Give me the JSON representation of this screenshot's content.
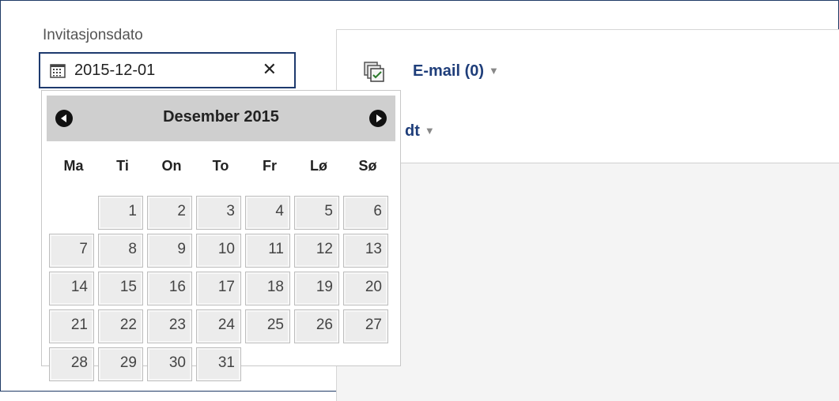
{
  "field": {
    "label": "Invitasjonsdato",
    "value": "2015-12-01"
  },
  "panel": {
    "email_tab": "E-mail (0)",
    "second_tab_visible": "dt"
  },
  "datepicker": {
    "month_title": "Desember 2015",
    "weekdays": [
      "Ma",
      "Ti",
      "On",
      "To",
      "Fr",
      "Lø",
      "Sø"
    ],
    "leading_blanks": 1,
    "days": [
      "1",
      "2",
      "3",
      "4",
      "5",
      "6",
      "7",
      "8",
      "9",
      "10",
      "11",
      "12",
      "13",
      "14",
      "15",
      "16",
      "17",
      "18",
      "19",
      "20",
      "21",
      "22",
      "23",
      "24",
      "25",
      "26",
      "27",
      "28",
      "29",
      "30",
      "31"
    ]
  },
  "icons": {
    "calendar": "calendar-icon",
    "clear": "close-icon",
    "email": "email-checkbox-icon",
    "prev": "prev-month-icon",
    "next": "next-month-icon"
  },
  "colors": {
    "border": "#1e3a6e",
    "link": "#1f3e7a",
    "header_bg": "#cfcfcf"
  }
}
